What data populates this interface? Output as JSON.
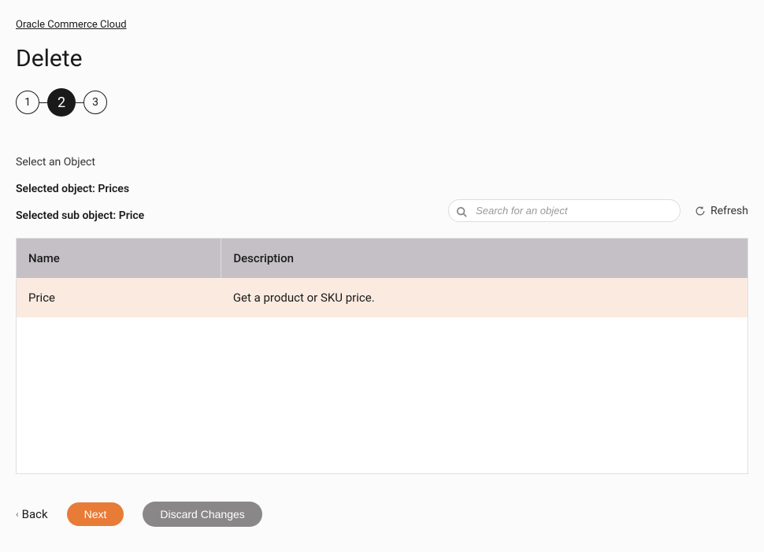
{
  "breadcrumb": "Oracle Commerce Cloud",
  "page_title": "Delete",
  "stepper": {
    "steps": [
      "1",
      "2",
      "3"
    ],
    "active_index": 1
  },
  "section_label": "Select an Object",
  "selected_object_label": "Selected object: Prices",
  "selected_sub_object_label": "Selected sub object: Price",
  "search": {
    "placeholder": "Search for an object"
  },
  "refresh_label": "Refresh",
  "table": {
    "headers": [
      "Name",
      "Description"
    ],
    "rows": [
      {
        "name": "Price",
        "description": "Get a product or SKU price.",
        "selected": true
      }
    ]
  },
  "actions": {
    "back": "Back",
    "next": "Next",
    "discard": "Discard Changes"
  }
}
